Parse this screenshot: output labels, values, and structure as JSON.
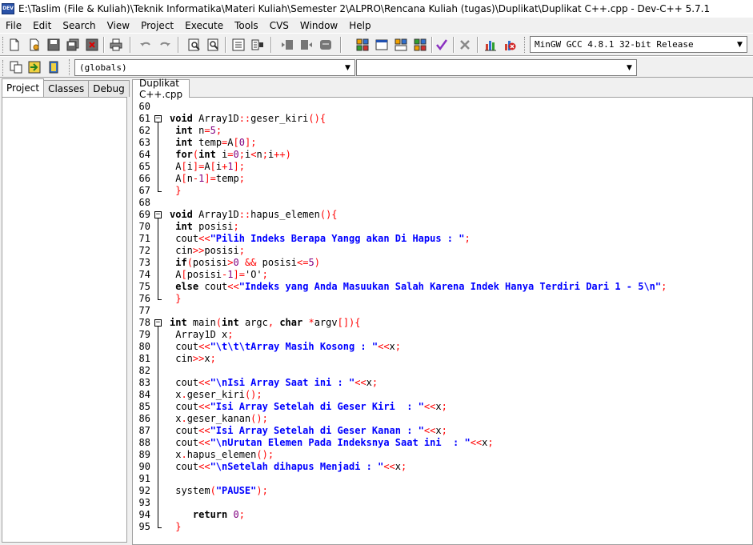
{
  "window": {
    "title": "E:\\Taslim (File & Kuliah)\\Teknik Informatika\\Materi Kuliah\\Semester 2\\ALPRO\\Rencana Kuliah (tugas)\\Duplikat\\Duplikat C++.cpp - Dev-C++ 5.7.1",
    "app_icon_text": "DEV"
  },
  "menu": [
    "File",
    "Edit",
    "Search",
    "View",
    "Project",
    "Execute",
    "Tools",
    "CVS",
    "Window",
    "Help"
  ],
  "toolbar": {
    "compiler": "MinGW GCC 4.8.1 32-bit Release",
    "scope": "(globals)",
    "function": ""
  },
  "left_tabs": [
    "Project",
    "Classes",
    "Debug"
  ],
  "editor_tab": "Duplikat C++.cpp",
  "colors": {
    "keyword": "#000000",
    "symbol": "#ff0000",
    "string": "#0000ff",
    "number": "#800080"
  },
  "code_lines": [
    {
      "n": "60",
      "fold": "none",
      "tokens": []
    },
    {
      "n": "61",
      "fold": "open",
      "tokens": [
        [
          "kw",
          "void"
        ],
        [
          "plain",
          " Array1D"
        ],
        [
          "sym",
          "::"
        ],
        [
          "plain",
          "geser_kiri"
        ],
        [
          "sym",
          "(){"
        ]
      ]
    },
    {
      "n": "62",
      "fold": "line",
      "tokens": [
        [
          "plain",
          " "
        ],
        [
          "kw",
          "int"
        ],
        [
          "plain",
          " n"
        ],
        [
          "sym",
          "="
        ],
        [
          "num",
          "5"
        ],
        [
          "sym",
          ";"
        ]
      ]
    },
    {
      "n": "63",
      "fold": "line",
      "tokens": [
        [
          "plain",
          " "
        ],
        [
          "kw",
          "int"
        ],
        [
          "plain",
          " temp"
        ],
        [
          "sym",
          "="
        ],
        [
          "plain",
          "A"
        ],
        [
          "sym",
          "["
        ],
        [
          "num",
          "0"
        ],
        [
          "sym",
          "];"
        ]
      ]
    },
    {
      "n": "64",
      "fold": "line",
      "tokens": [
        [
          "plain",
          " "
        ],
        [
          "kw",
          "for"
        ],
        [
          "sym",
          "("
        ],
        [
          "kw",
          "int"
        ],
        [
          "plain",
          " i"
        ],
        [
          "sym",
          "="
        ],
        [
          "num",
          "0"
        ],
        [
          "sym",
          ";"
        ],
        [
          "plain",
          "i"
        ],
        [
          "sym",
          "<"
        ],
        [
          "plain",
          "n"
        ],
        [
          "sym",
          ";"
        ],
        [
          "plain",
          "i"
        ],
        [
          "sym",
          "++)"
        ]
      ]
    },
    {
      "n": "65",
      "fold": "line",
      "tokens": [
        [
          "plain",
          " A"
        ],
        [
          "sym",
          "["
        ],
        [
          "plain",
          "i"
        ],
        [
          "sym",
          "]="
        ],
        [
          "plain",
          "A"
        ],
        [
          "sym",
          "["
        ],
        [
          "plain",
          "i"
        ],
        [
          "sym",
          "+"
        ],
        [
          "num",
          "1"
        ],
        [
          "sym",
          "];"
        ]
      ]
    },
    {
      "n": "66",
      "fold": "line",
      "tokens": [
        [
          "plain",
          " A"
        ],
        [
          "sym",
          "["
        ],
        [
          "plain",
          "n"
        ],
        [
          "sym",
          "-"
        ],
        [
          "num",
          "1"
        ],
        [
          "sym",
          "]="
        ],
        [
          "plain",
          "temp"
        ],
        [
          "sym",
          ";"
        ]
      ]
    },
    {
      "n": "67",
      "fold": "end",
      "tokens": [
        [
          "sym",
          " }"
        ]
      ]
    },
    {
      "n": "68",
      "fold": "none",
      "tokens": []
    },
    {
      "n": "69",
      "fold": "open",
      "tokens": [
        [
          "kw",
          "void"
        ],
        [
          "plain",
          " Array1D"
        ],
        [
          "sym",
          "::"
        ],
        [
          "plain",
          "hapus_elemen"
        ],
        [
          "sym",
          "(){"
        ]
      ]
    },
    {
      "n": "70",
      "fold": "line",
      "tokens": [
        [
          "plain",
          " "
        ],
        [
          "kw",
          "int"
        ],
        [
          "plain",
          " posisi"
        ],
        [
          "sym",
          ";"
        ]
      ]
    },
    {
      "n": "71",
      "fold": "line",
      "tokens": [
        [
          "plain",
          " cout"
        ],
        [
          "sym",
          "<<"
        ],
        [
          "str",
          "\"Pilih Indeks Berapa Yangg akan Di Hapus : \""
        ],
        [
          "sym",
          ";"
        ]
      ]
    },
    {
      "n": "72",
      "fold": "line",
      "tokens": [
        [
          "plain",
          " cin"
        ],
        [
          "sym",
          ">>"
        ],
        [
          "plain",
          "posisi"
        ],
        [
          "sym",
          ";"
        ]
      ]
    },
    {
      "n": "73",
      "fold": "line",
      "tokens": [
        [
          "plain",
          " "
        ],
        [
          "kw",
          "if"
        ],
        [
          "sym",
          "("
        ],
        [
          "plain",
          "posisi"
        ],
        [
          "sym",
          ">"
        ],
        [
          "num",
          "0"
        ],
        [
          "plain",
          " "
        ],
        [
          "sym",
          "&&"
        ],
        [
          "plain",
          " posisi"
        ],
        [
          "sym",
          "<="
        ],
        [
          "num",
          "5"
        ],
        [
          "sym",
          ")"
        ]
      ]
    },
    {
      "n": "74",
      "fold": "line",
      "tokens": [
        [
          "plain",
          " A"
        ],
        [
          "sym",
          "["
        ],
        [
          "plain",
          "posisi"
        ],
        [
          "sym",
          "-"
        ],
        [
          "num",
          "1"
        ],
        [
          "sym",
          "]="
        ],
        [
          "plain",
          "'O'"
        ],
        [
          "sym",
          ";"
        ]
      ]
    },
    {
      "n": "75",
      "fold": "line",
      "tokens": [
        [
          "plain",
          " "
        ],
        [
          "kw",
          "else"
        ],
        [
          "plain",
          " cout"
        ],
        [
          "sym",
          "<<"
        ],
        [
          "str",
          "\"Indeks yang Anda Masuukan Salah Karena Indek Hanya Terdiri Dari 1 - 5\\n\""
        ],
        [
          "sym",
          ";"
        ]
      ]
    },
    {
      "n": "76",
      "fold": "end",
      "tokens": [
        [
          "sym",
          " }"
        ]
      ]
    },
    {
      "n": "77",
      "fold": "none",
      "tokens": []
    },
    {
      "n": "78",
      "fold": "open",
      "tokens": [
        [
          "kw",
          "int"
        ],
        [
          "plain",
          " main"
        ],
        [
          "sym",
          "("
        ],
        [
          "kw",
          "int"
        ],
        [
          "plain",
          " argc"
        ],
        [
          "sym",
          ","
        ],
        [
          "plain",
          " "
        ],
        [
          "kw",
          "char"
        ],
        [
          "plain",
          " "
        ],
        [
          "sym",
          "*"
        ],
        [
          "plain",
          "argv"
        ],
        [
          "sym",
          "[]){"
        ]
      ]
    },
    {
      "n": "79",
      "fold": "line",
      "tokens": [
        [
          "plain",
          " Array1D x"
        ],
        [
          "sym",
          ";"
        ]
      ]
    },
    {
      "n": "80",
      "fold": "line",
      "tokens": [
        [
          "plain",
          " cout"
        ],
        [
          "sym",
          "<<"
        ],
        [
          "str",
          "\"\\t\\t\\tArray Masih Kosong : \""
        ],
        [
          "sym",
          "<<"
        ],
        [
          "plain",
          "x"
        ],
        [
          "sym",
          ";"
        ]
      ]
    },
    {
      "n": "81",
      "fold": "line",
      "tokens": [
        [
          "plain",
          " cin"
        ],
        [
          "sym",
          ">>"
        ],
        [
          "plain",
          "x"
        ],
        [
          "sym",
          ";"
        ]
      ]
    },
    {
      "n": "82",
      "fold": "line",
      "tokens": []
    },
    {
      "n": "83",
      "fold": "line",
      "tokens": [
        [
          "plain",
          " cout"
        ],
        [
          "sym",
          "<<"
        ],
        [
          "str",
          "\"\\nIsi Array Saat ini : \""
        ],
        [
          "sym",
          "<<"
        ],
        [
          "plain",
          "x"
        ],
        [
          "sym",
          ";"
        ]
      ]
    },
    {
      "n": "84",
      "fold": "line",
      "tokens": [
        [
          "plain",
          " x"
        ],
        [
          "sym",
          "."
        ],
        [
          "plain",
          "geser_kiri"
        ],
        [
          "sym",
          "();"
        ]
      ]
    },
    {
      "n": "85",
      "fold": "line",
      "tokens": [
        [
          "plain",
          " cout"
        ],
        [
          "sym",
          "<<"
        ],
        [
          "str",
          "\"Isi Array Setelah di Geser Kiri  : \""
        ],
        [
          "sym",
          "<<"
        ],
        [
          "plain",
          "x"
        ],
        [
          "sym",
          ";"
        ]
      ]
    },
    {
      "n": "86",
      "fold": "line",
      "tokens": [
        [
          "plain",
          " x"
        ],
        [
          "sym",
          "."
        ],
        [
          "plain",
          "geser_kanan"
        ],
        [
          "sym",
          "();"
        ]
      ]
    },
    {
      "n": "87",
      "fold": "line",
      "tokens": [
        [
          "plain",
          " cout"
        ],
        [
          "sym",
          "<<"
        ],
        [
          "str",
          "\"Isi Array Setelah di Geser Kanan : \""
        ],
        [
          "sym",
          "<<"
        ],
        [
          "plain",
          "x"
        ],
        [
          "sym",
          ";"
        ]
      ]
    },
    {
      "n": "88",
      "fold": "line",
      "tokens": [
        [
          "plain",
          " cout"
        ],
        [
          "sym",
          "<<"
        ],
        [
          "str",
          "\"\\nUrutan Elemen Pada Indeksnya Saat ini  : \""
        ],
        [
          "sym",
          "<<"
        ],
        [
          "plain",
          "x"
        ],
        [
          "sym",
          ";"
        ]
      ]
    },
    {
      "n": "89",
      "fold": "line",
      "tokens": [
        [
          "plain",
          " x"
        ],
        [
          "sym",
          "."
        ],
        [
          "plain",
          "hapus_elemen"
        ],
        [
          "sym",
          "();"
        ]
      ]
    },
    {
      "n": "90",
      "fold": "line",
      "tokens": [
        [
          "plain",
          " cout"
        ],
        [
          "sym",
          "<<"
        ],
        [
          "str",
          "\"\\nSetelah dihapus Menjadi : \""
        ],
        [
          "sym",
          "<<"
        ],
        [
          "plain",
          "x"
        ],
        [
          "sym",
          ";"
        ]
      ]
    },
    {
      "n": "91",
      "fold": "line",
      "tokens": []
    },
    {
      "n": "92",
      "fold": "line",
      "tokens": [
        [
          "plain",
          " system"
        ],
        [
          "sym",
          "("
        ],
        [
          "str",
          "\"PAUSE\""
        ],
        [
          "sym",
          ");"
        ]
      ]
    },
    {
      "n": "93",
      "fold": "line",
      "tokens": []
    },
    {
      "n": "94",
      "fold": "line",
      "tokens": [
        [
          "plain",
          "    "
        ],
        [
          "kw",
          "return"
        ],
        [
          "plain",
          " "
        ],
        [
          "num",
          "0"
        ],
        [
          "sym",
          ";"
        ]
      ]
    },
    {
      "n": "95",
      "fold": "end",
      "tokens": [
        [
          "sym",
          " }"
        ]
      ]
    }
  ]
}
